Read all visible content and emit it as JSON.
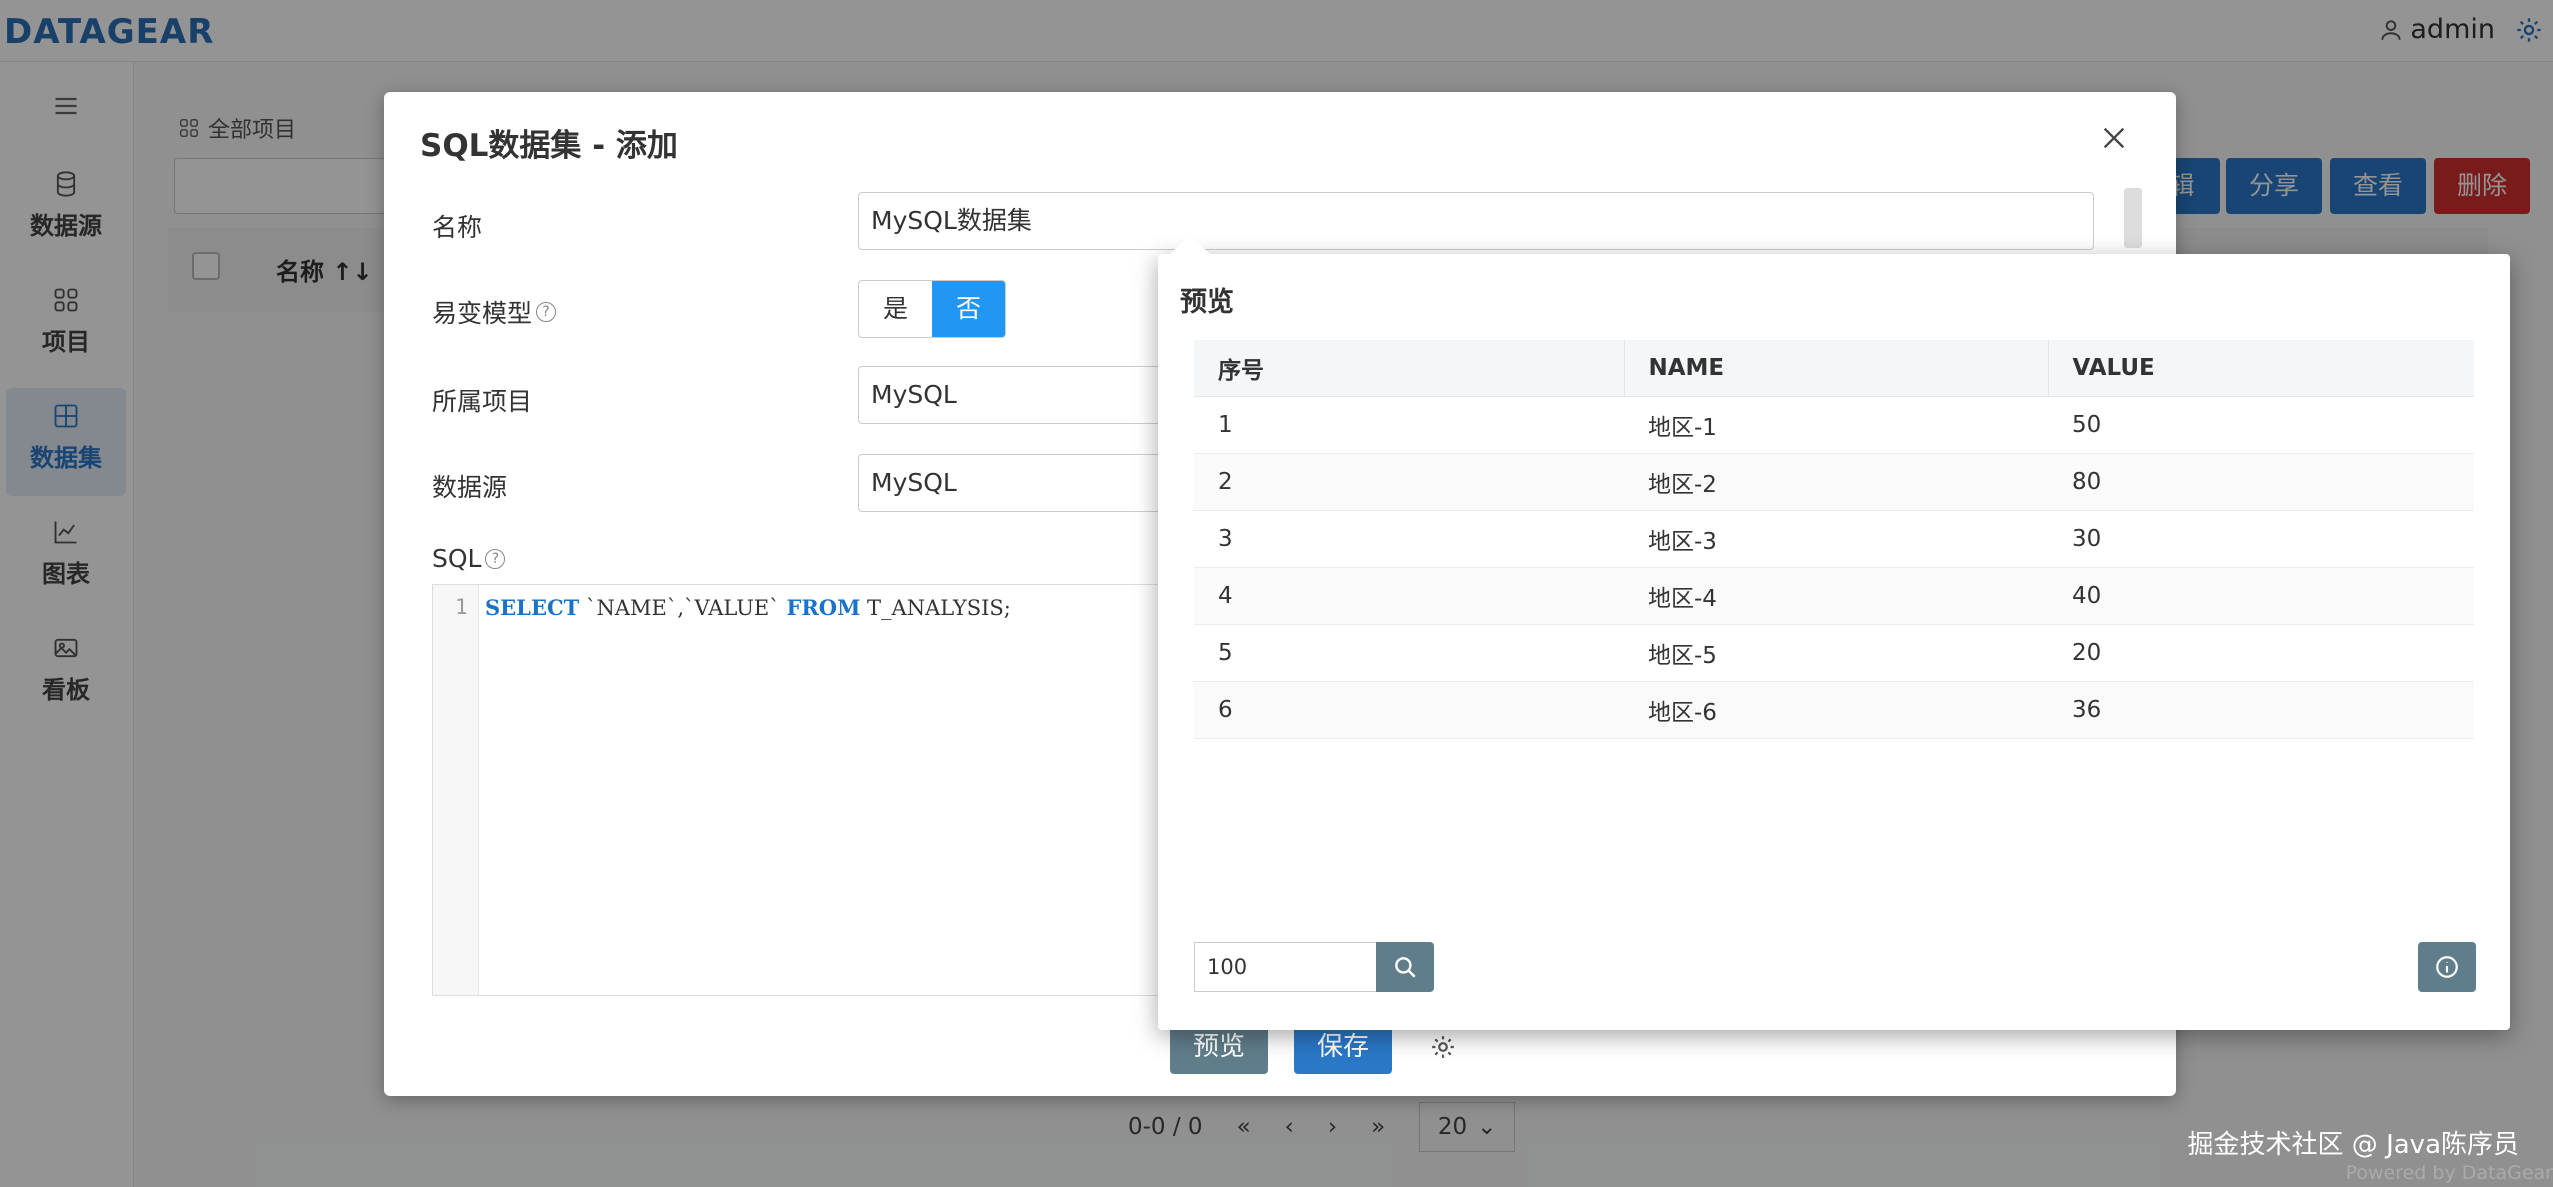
{
  "app": {
    "logo": "DATAGEAR",
    "user": "admin",
    "powered_by": "Powered by DataGear",
    "watermark": "掘金技术社区 @ Java陈序员"
  },
  "sidebar": {
    "items": [
      {
        "label": "数据源",
        "icon": "database-icon"
      },
      {
        "label": "项目",
        "icon": "grid-icon"
      },
      {
        "label": "数据集",
        "icon": "table-icon",
        "active": true
      },
      {
        "label": "图表",
        "icon": "chart-icon"
      },
      {
        "label": "看板",
        "icon": "image-icon"
      }
    ]
  },
  "main": {
    "breadcrumb": "全部项目",
    "column_name": "名称",
    "actions": {
      "edit": "辑",
      "share": "分享",
      "view": "查看",
      "delete": "删除"
    },
    "pager": {
      "info": "0-0 / 0",
      "page_size": "20"
    }
  },
  "dialog": {
    "title": "SQL数据集 - 添加",
    "fields": {
      "name_label": "名称",
      "name_value": "MySQL数据集",
      "mutable_label": "易变模型",
      "mutable_yes": "是",
      "mutable_no": "否",
      "project_label": "所属项目",
      "project_value": "MySQL",
      "datasource_label": "数据源",
      "datasource_value": "MySQL",
      "sql_label": "SQL"
    },
    "sql": {
      "line_no": "1",
      "kw_select": "SELECT",
      "cols": " `NAME`,`VALUE` ",
      "kw_from": "FROM",
      "table": " T_ANALYSIS;"
    },
    "buttons": {
      "preview": "预览",
      "save": "保存"
    }
  },
  "preview": {
    "title": "预览",
    "columns": [
      "序号",
      "NAME",
      "VALUE"
    ],
    "rows": [
      [
        "1",
        "地区-1",
        "50"
      ],
      [
        "2",
        "地区-2",
        "80"
      ],
      [
        "3",
        "地区-3",
        "30"
      ],
      [
        "4",
        "地区-4",
        "40"
      ],
      [
        "5",
        "地区-5",
        "20"
      ],
      [
        "6",
        "地区-6",
        "36"
      ]
    ],
    "fetch_size": "100"
  },
  "colors": {
    "primary": "#2196f3",
    "danger": "#d32f2f",
    "slate": "#607d8b"
  }
}
